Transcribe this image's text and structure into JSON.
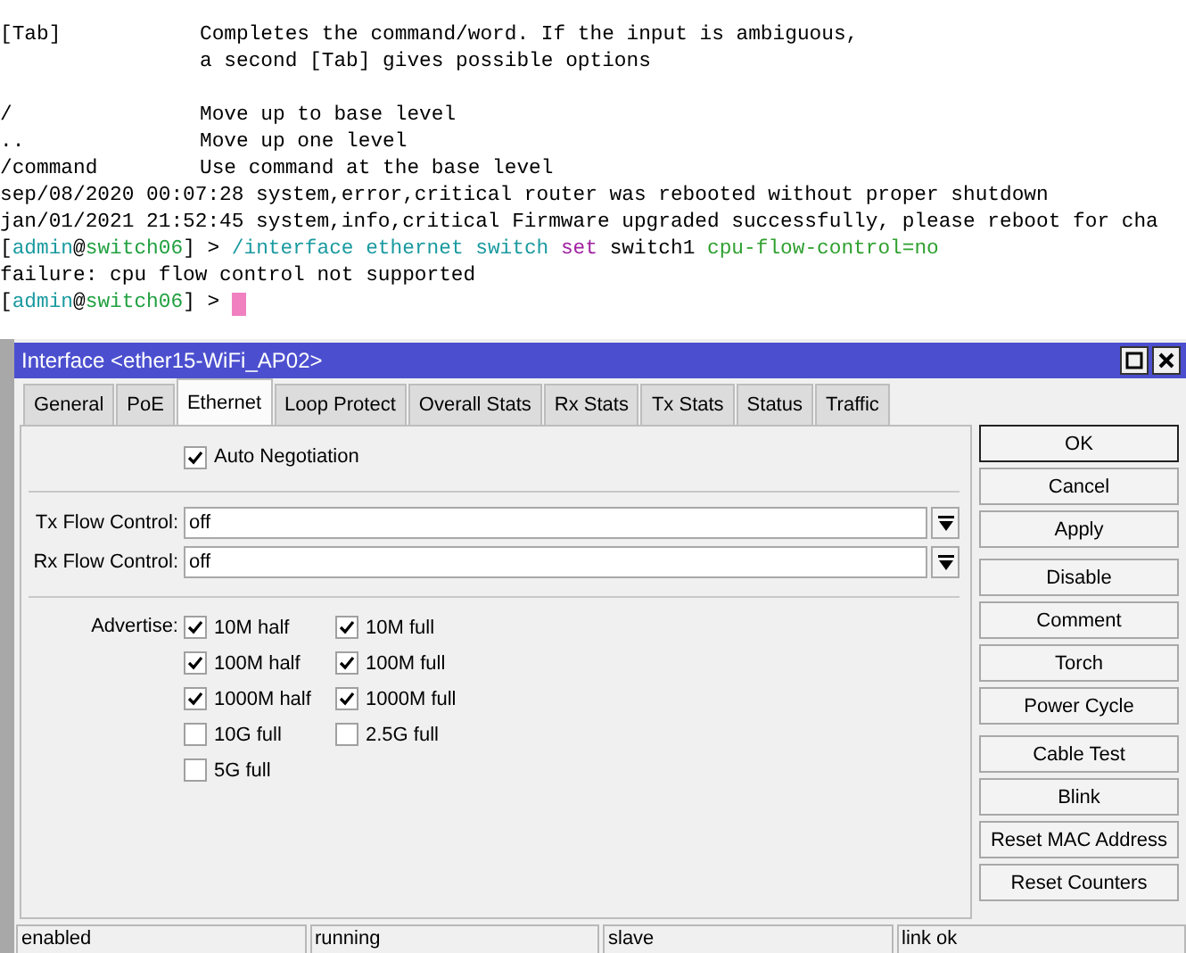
{
  "terminal": {
    "help": [
      {
        "key": "[Tab]",
        "lines": [
          "Completes the command/word. If the input is ambiguous,",
          "a second [Tab] gives possible options"
        ]
      },
      {
        "key": "/",
        "lines": [
          "Move up to base level"
        ]
      },
      {
        "key": "..",
        "lines": [
          "Move up one level"
        ]
      },
      {
        "key": "/command",
        "lines": [
          "Use command at the base level"
        ]
      }
    ],
    "log": [
      [
        {
          "text": "sep/08/2020 00:07:28 system,error,critical router was rebooted without proper shutdown",
          "kind": "plain"
        }
      ],
      [
        {
          "text": "jan/01/2021 21:52:45 system,info,critical Firmware upgraded successfully, please reboot for cha",
          "kind": "plain"
        }
      ],
      [
        {
          "text": "[",
          "kind": "plain"
        },
        {
          "text": "admin",
          "kind": "user"
        },
        {
          "text": "@",
          "kind": "plain"
        },
        {
          "text": "switch06",
          "kind": "host"
        },
        {
          "text": "] > ",
          "kind": "plain"
        },
        {
          "text": "/interface ethernet switch ",
          "kind": "path"
        },
        {
          "text": "set",
          "kind": "command"
        },
        {
          "text": " switch1 ",
          "kind": "plain"
        },
        {
          "text": "cpu-flow-control=no",
          "kind": "argument"
        }
      ],
      [
        {
          "text": "failure: cpu flow control not supported",
          "kind": "plain"
        }
      ],
      [
        {
          "text": "[",
          "kind": "plain"
        },
        {
          "text": "admin",
          "kind": "user"
        },
        {
          "text": "@",
          "kind": "plain"
        },
        {
          "text": "switch06",
          "kind": "host"
        },
        {
          "text": "] > ",
          "kind": "plain"
        }
      ]
    ],
    "cursor": true
  },
  "window": {
    "title": "Interface <ether15-WiFi_AP02>",
    "tabs": [
      {
        "label": "General",
        "selected": false
      },
      {
        "label": "PoE",
        "selected": false
      },
      {
        "label": "Ethernet",
        "selected": true
      },
      {
        "label": "Loop Protect",
        "selected": false
      },
      {
        "label": "Overall Stats",
        "selected": false
      },
      {
        "label": "Rx Stats",
        "selected": false
      },
      {
        "label": "Tx Stats",
        "selected": false
      },
      {
        "label": "Status",
        "selected": false
      },
      {
        "label": "Traffic",
        "selected": false
      }
    ],
    "auto_negotiation": {
      "label": "Auto Negotiation",
      "checked": true
    },
    "fields": [
      {
        "label": "Tx Flow Control:",
        "value": "off"
      },
      {
        "label": "Rx Flow Control:",
        "value": "off"
      }
    ],
    "advertise": {
      "label": "Advertise:",
      "options": [
        {
          "label": "10M half",
          "checked": true
        },
        {
          "label": "10M full",
          "checked": true
        },
        {
          "label": "100M half",
          "checked": true
        },
        {
          "label": "100M full",
          "checked": true
        },
        {
          "label": "1000M half",
          "checked": true
        },
        {
          "label": "1000M full",
          "checked": true
        },
        {
          "label": "10G full",
          "checked": false
        },
        {
          "label": "2.5G full",
          "checked": false
        },
        {
          "label": "5G full",
          "checked": false
        }
      ]
    },
    "button_groups": [
      [
        {
          "label": "OK",
          "focused": true
        },
        {
          "label": "Cancel",
          "focused": false
        },
        {
          "label": "Apply",
          "focused": false
        }
      ],
      [
        {
          "label": "Disable",
          "focused": false
        },
        {
          "label": "Comment",
          "focused": false
        },
        {
          "label": "Torch",
          "focused": false
        },
        {
          "label": "Power Cycle",
          "focused": false
        }
      ],
      [
        {
          "label": "Cable Test",
          "focused": false
        },
        {
          "label": "Blink",
          "focused": false
        },
        {
          "label": "Reset MAC Address",
          "focused": false
        },
        {
          "label": "Reset Counters",
          "focused": false
        }
      ]
    ],
    "status_bar": [
      "enabled",
      "running",
      "slave",
      "link ok"
    ]
  }
}
